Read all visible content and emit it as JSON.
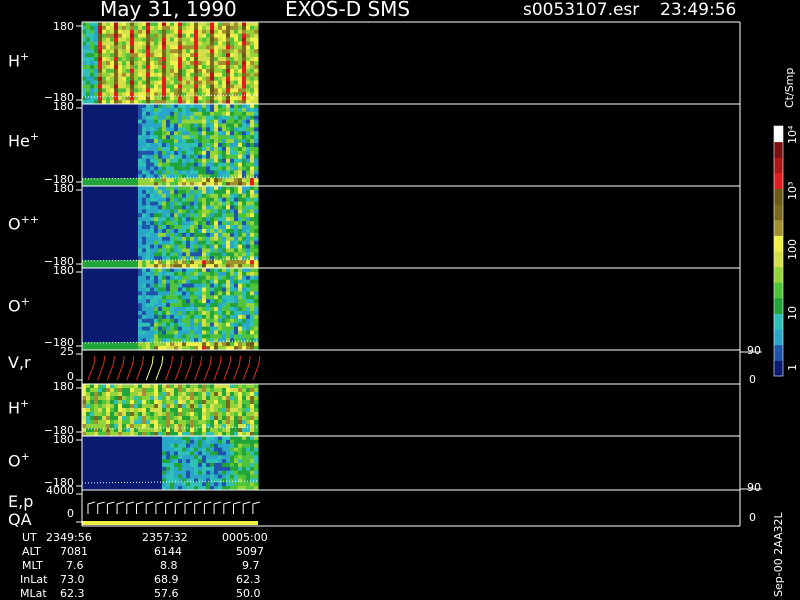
{
  "header": {
    "date": "May 31, 1990",
    "instrument": "EXOS-D SMS",
    "file": "s0053107.esr",
    "time": "23:49:56"
  },
  "panels": [
    {
      "id": "h1",
      "name": "H",
      "sup": "+",
      "ymax": "180",
      "ymin": "−180"
    },
    {
      "id": "he",
      "name": "He",
      "sup": "+",
      "ymax": "180",
      "ymin": "−180"
    },
    {
      "id": "opp",
      "name": "O",
      "sup": "++",
      "ymax": "180",
      "ymin": "−180"
    },
    {
      "id": "o1",
      "name": "O",
      "sup": "+",
      "ymax": "180",
      "ymin": "−180"
    },
    {
      "id": "vr",
      "name": "V,r",
      "sup": "",
      "ymax": "25",
      "ymin": "0",
      "rmax": "90",
      "rmin": "0"
    },
    {
      "id": "h2",
      "name": "H",
      "sup": "+",
      "ymax": "180",
      "ymin": "−180"
    },
    {
      "id": "o2",
      "name": "O",
      "sup": "+",
      "ymax": "180",
      "ymin": "−180"
    },
    {
      "id": "ep",
      "name": "E,p",
      "sup": "",
      "ymax": "4000",
      "ymin": "0",
      "rmax": "90",
      "rmin": "0",
      "name2": "QA"
    }
  ],
  "colorbar": {
    "unit": "Ct/Smp",
    "labels": [
      "1",
      "10",
      "100",
      "10³",
      "10⁴"
    ],
    "colors": [
      "#0a1a70",
      "#1f54a8",
      "#2aa7c8",
      "#2fc0b8",
      "#21a53a",
      "#4fc43a",
      "#94d43a",
      "#d4e04a",
      "#f0f04a",
      "#a09030",
      "#7a6a20",
      "#6a5a18",
      "#e02020",
      "#b01818",
      "#7a1010",
      "#ffffff"
    ]
  },
  "footer": {
    "rows": [
      {
        "label": "UT",
        "v1": "2349:56",
        "v2": "2357:32",
        "v3": "0005:00"
      },
      {
        "label": "ALT",
        "v1": "7081",
        "v2": "6144",
        "v3": "5097"
      },
      {
        "label": "MLT",
        "v1": "7.6",
        "v2": "8.8",
        "v3": "9.7"
      },
      {
        "label": "InLat",
        "v1": "73.0",
        "v2": "68.9",
        "v3": "62.3"
      },
      {
        "label": "MLat",
        "v1": "62.3",
        "v2": "57.6",
        "v3": "50.0"
      }
    ],
    "side_label": "Sep-00 2AA32L"
  },
  "chart_data": {
    "type": "heatmap",
    "title": "May 31, 1990   EXOS-D SMS",
    "time_axis": [
      "2349:56",
      "2357:32",
      "0005:00"
    ],
    "y_range_pitch": [
      -180,
      180
    ],
    "color_scale": "log",
    "color_range": [
      1,
      10000
    ],
    "colorbar_label": "Ct/Smp",
    "series": [
      {
        "name": "H+",
        "ylim": [
          -180,
          180
        ]
      },
      {
        "name": "He+",
        "ylim": [
          -180,
          180
        ]
      },
      {
        "name": "O++",
        "ylim": [
          -180,
          180
        ]
      },
      {
        "name": "O+",
        "ylim": [
          -180,
          180
        ]
      },
      {
        "name": "V,r",
        "ylim": [
          0,
          25
        ],
        "right_ylim": [
          0,
          90
        ]
      },
      {
        "name": "H+",
        "ylim": [
          -180,
          180
        ]
      },
      {
        "name": "O+",
        "ylim": [
          -180,
          180
        ]
      },
      {
        "name": "E,p",
        "ylim": [
          0,
          4000
        ],
        "right_ylim": [
          0,
          90
        ]
      },
      {
        "name": "QA"
      }
    ]
  }
}
